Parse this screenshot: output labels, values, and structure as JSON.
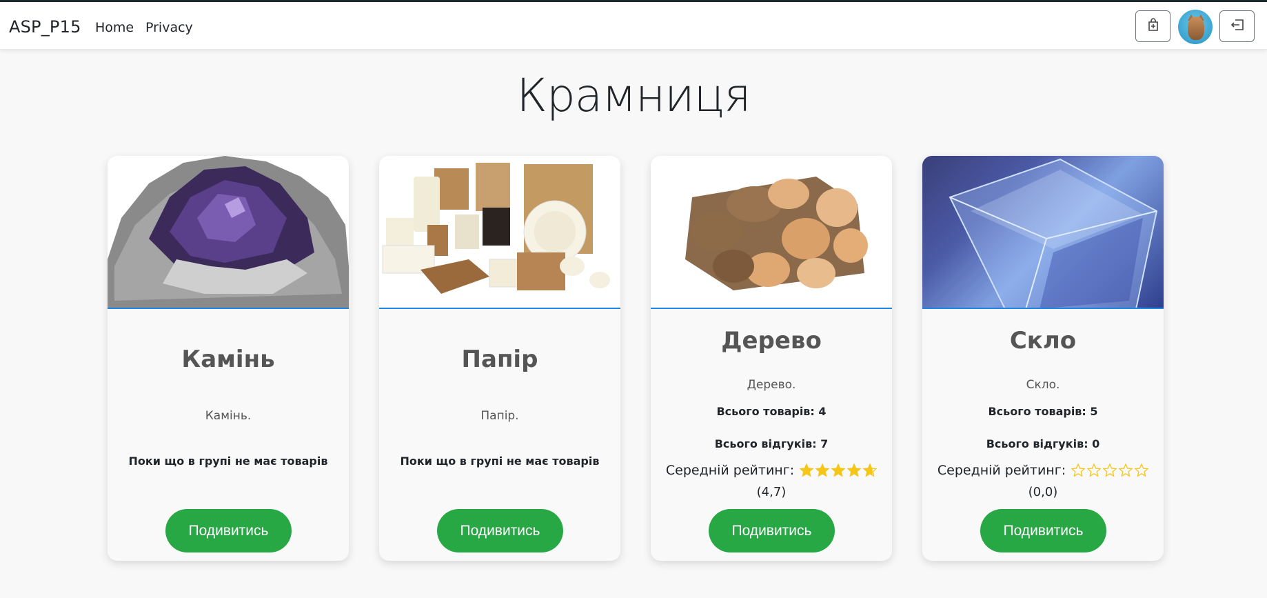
{
  "navbar": {
    "brand": "ASP_P15",
    "links": [
      {
        "label": "Home"
      },
      {
        "label": "Privacy"
      }
    ],
    "icons": [
      "cart-add-icon",
      "avatar",
      "logout-icon"
    ]
  },
  "page": {
    "title": "Крамниця"
  },
  "colors": {
    "accent": "#28a745",
    "image_border": "#1e88e5",
    "star": "#f5c518"
  },
  "cards": [
    {
      "title": "Камінь",
      "description": "Камінь.",
      "no_items_text": "Поки що в групі не має товарів",
      "button_label": "Подивитись",
      "image": "amethyst-stone"
    },
    {
      "title": "Папір",
      "description": "Папір.",
      "no_items_text": "Поки що в групі не має товарів",
      "button_label": "Подивитись",
      "image": "paper-packaging"
    },
    {
      "title": "Дерево",
      "description": "Дерево.",
      "total_items": "Всього товарів: 4",
      "total_reviews": "Всього відгуків: 7",
      "rating_label": "Середній рейтинг:",
      "rating": 4.7,
      "rating_text": "(4,7)",
      "button_label": "Подивитись",
      "image": "firewood"
    },
    {
      "title": "Скло",
      "description": "Скло.",
      "total_items": "Всього товарів: 5",
      "total_reviews": "Всього відгуків: 0",
      "rating_label": "Середній рейтинг:",
      "rating": 0,
      "rating_text": "(0,0)",
      "button_label": "Подивитись",
      "image": "glass-cube"
    }
  ]
}
